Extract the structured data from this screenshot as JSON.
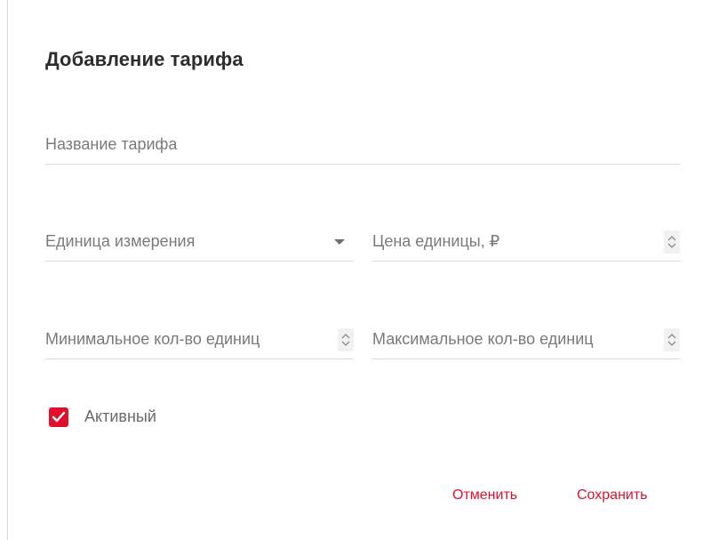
{
  "dialog": {
    "title": "Добавление тарифа",
    "accent_color": "#e0102b"
  },
  "form": {
    "tariff_name": {
      "placeholder": "Название тарифа",
      "value": ""
    },
    "unit": {
      "placeholder": "Единица измерения",
      "value": "",
      "icon": "dropdown-arrow-icon"
    },
    "unit_price": {
      "placeholder": "Цена единицы, ₽",
      "value": "",
      "icon": "spinner-icon"
    },
    "min_units": {
      "placeholder": "Минимальное кол-во единиц",
      "value": "",
      "icon": "spinner-icon"
    },
    "max_units": {
      "placeholder": "Максимальное кол-во единиц",
      "value": "",
      "icon": "spinner-icon"
    },
    "active": {
      "label": "Активный",
      "checked": true,
      "icon": "check-icon"
    }
  },
  "actions": {
    "cancel_label": "Отменить",
    "save_label": "Сохранить"
  }
}
